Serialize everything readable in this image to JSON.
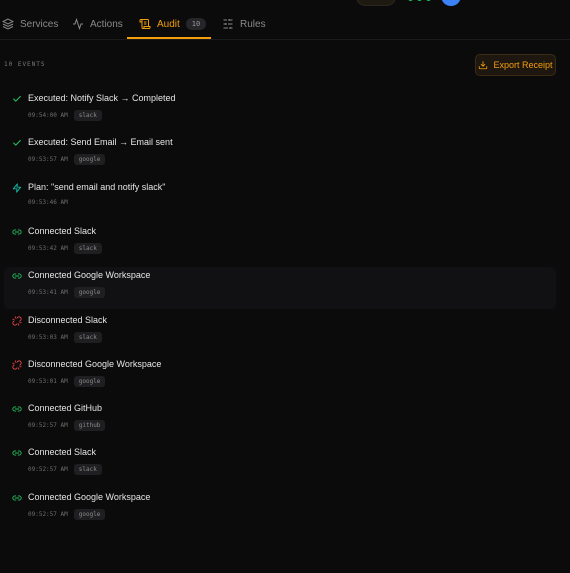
{
  "colors": {
    "accent": "#f59e0b",
    "success": "#22c55e",
    "plan": "#14b8a6",
    "danger": "#ef4444",
    "background": "#0b0b0c"
  },
  "tabs": [
    {
      "label": "Services",
      "icon": "layers-icon"
    },
    {
      "label": "Actions",
      "icon": "activity-icon"
    },
    {
      "label": "Audit",
      "icon": "scroll-icon",
      "badge": "10",
      "active": true
    },
    {
      "label": "Rules",
      "icon": "sliders-icon"
    }
  ],
  "audit": {
    "count_label": "10 EVENTS",
    "export_label": "Export Receipt"
  },
  "events": [
    {
      "kind": "check",
      "title": "Executed: Notify Slack → Completed",
      "time": "09:54:00 AM",
      "service": "slack"
    },
    {
      "kind": "check",
      "title": "Executed: Send Email → Email sent",
      "time": "09:53:57 AM",
      "service": "google"
    },
    {
      "kind": "plan",
      "title": "Plan: \"send email and notify slack\"",
      "time": "09:53:46 AM",
      "service": ""
    },
    {
      "kind": "link",
      "title": "Connected Slack",
      "time": "09:53:42 AM",
      "service": "slack"
    },
    {
      "kind": "link",
      "title": "Connected Google Workspace",
      "time": "09:53:41 AM",
      "service": "google"
    },
    {
      "kind": "unlink",
      "title": "Disconnected Slack",
      "time": "09:53:03 AM",
      "service": "slack"
    },
    {
      "kind": "unlink",
      "title": "Disconnected Google Workspace",
      "time": "09:53:01 AM",
      "service": "google"
    },
    {
      "kind": "link",
      "title": "Connected GitHub",
      "time": "09:52:57 AM",
      "service": "github"
    },
    {
      "kind": "link",
      "title": "Connected Slack",
      "time": "09:52:57 AM",
      "service": "slack"
    },
    {
      "kind": "link",
      "title": "Connected Google Workspace",
      "time": "09:52:57 AM",
      "service": "google"
    }
  ]
}
